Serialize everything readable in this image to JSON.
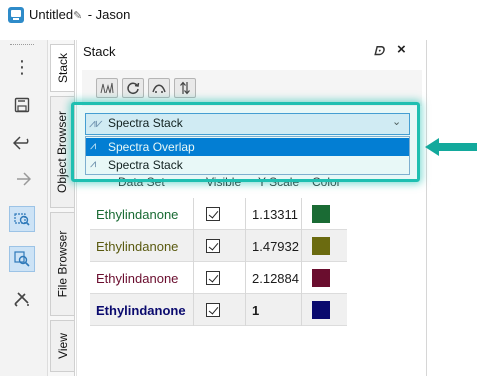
{
  "window": {
    "title": "Untitled",
    "title_suffix": " - Jason"
  },
  "toolbar": {
    "items": [
      {
        "icon": "more-vertical-icon",
        "selected": false
      },
      {
        "icon": "save-icon",
        "selected": false
      },
      {
        "icon": "undo-icon",
        "selected": false
      },
      {
        "icon": "redo-icon",
        "selected": false
      },
      {
        "icon": "zoom-icon",
        "selected": true
      },
      {
        "icon": "zoom-region-icon",
        "selected": true
      },
      {
        "icon": "cursor-tool-icon",
        "selected": false
      }
    ]
  },
  "side_tabs": [
    {
      "label": "Stack",
      "active": true
    },
    {
      "label": "Object Browser",
      "active": false
    },
    {
      "label": "File Browser",
      "active": false
    },
    {
      "label": "View",
      "active": false
    }
  ],
  "panel": {
    "title": "Stack",
    "toolbar_buttons": [
      "spectra-overlay-icon",
      "refresh-icon",
      "stack-icon",
      "sort-icon"
    ]
  },
  "dropdown": {
    "selected": "Spectra Stack",
    "options": [
      {
        "label": "Spectra Overlap",
        "highlighted": true
      },
      {
        "label": "Spectra Stack",
        "highlighted": false
      }
    ]
  },
  "table": {
    "columns": [
      "Data Set",
      "Visible",
      "Y Scale",
      "Color"
    ],
    "rows": [
      {
        "name": "Ethylindanone",
        "visible": true,
        "y_scale": "1.13311",
        "color": "#1a6b34",
        "name_color": "#1a6b34",
        "bold": false
      },
      {
        "name": "Ethylindanone",
        "visible": true,
        "y_scale": "1.47932",
        "color": "#6b6b10",
        "name_color": "#5a5a10",
        "bold": false
      },
      {
        "name": "Ethylindanone",
        "visible": true,
        "y_scale": "2.12884",
        "color": "#6a0d2e",
        "name_color": "#6a0d2e",
        "bold": false
      },
      {
        "name": "Ethylindanone",
        "visible": true,
        "y_scale": "1",
        "color": "#0a0a6e",
        "name_color": "#0a0a6e",
        "bold": true
      }
    ]
  },
  "colors": {
    "accent": "#0078d7",
    "highlight": "#1fbfb1"
  }
}
